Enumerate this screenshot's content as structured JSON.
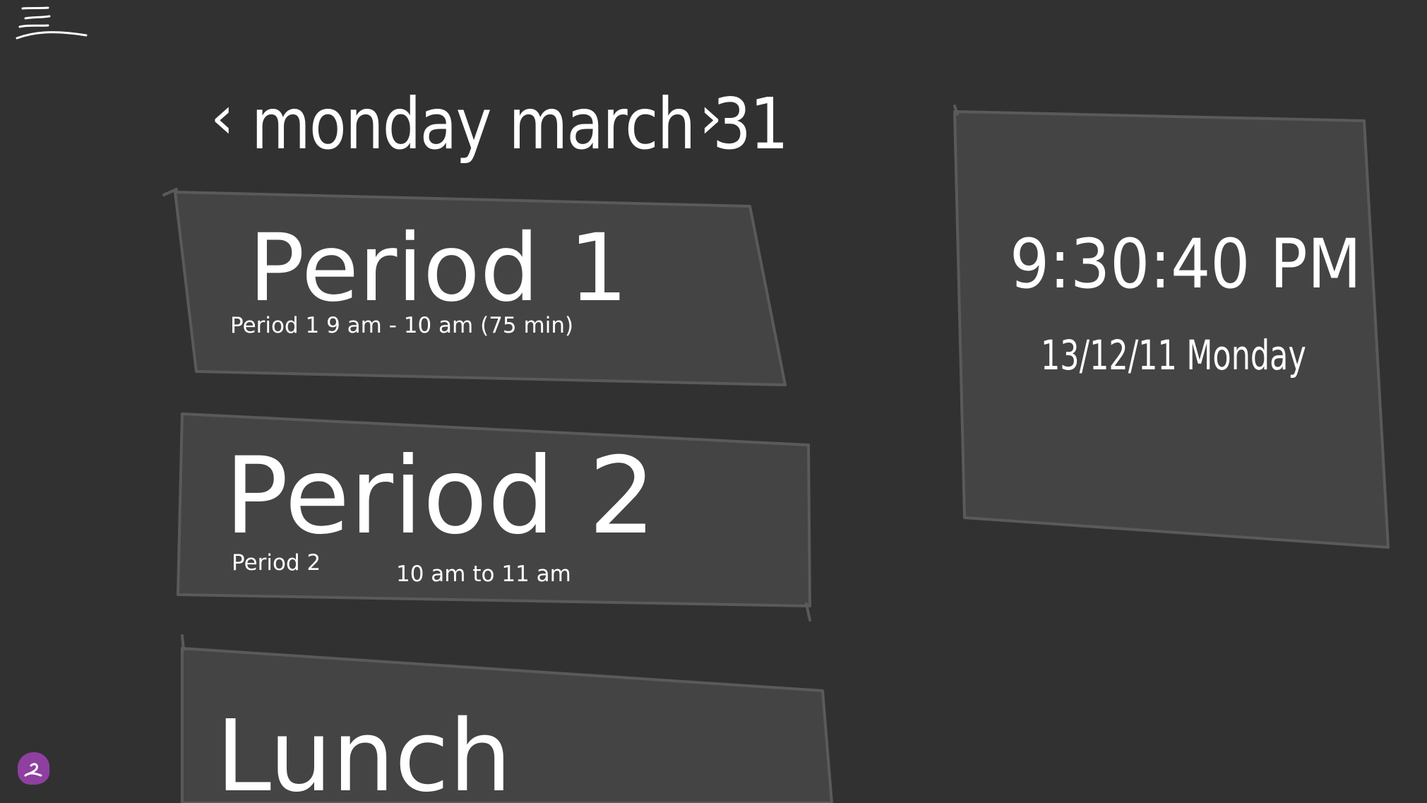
{
  "nav": {
    "prev_symbol": "‹",
    "next_symbol": "›",
    "day_title": "monday march 31"
  },
  "periods": [
    {
      "title": "Period 1",
      "detail": "Period 1 9 am - 10 am (75 min)"
    },
    {
      "title": "Period 2",
      "name": "Period 2",
      "time": "10 am to 11 am"
    },
    {
      "title": "Lunch"
    }
  ],
  "clock_panel": {
    "time": "9:30:40 PM",
    "date": "13/12/11 Monday"
  },
  "icons": {
    "menu": "menu-icon",
    "profile": "profile-badge-icon"
  },
  "colors": {
    "background": "#313131",
    "card": "#444444",
    "card_border": "#5a5a5a",
    "text": "#ffffff",
    "badge": "#8e3fa0"
  }
}
